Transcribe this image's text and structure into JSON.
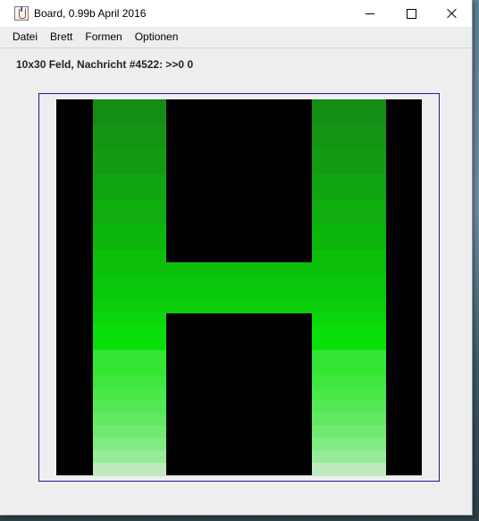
{
  "window": {
    "title": "Board, 0.99b April 2016",
    "icon": "java-cup-icon"
  },
  "menu": {
    "items": [
      "Datei",
      "Brett",
      "Formen",
      "Optionen"
    ]
  },
  "status": {
    "text": "10x30 Feld, Nachricht #4522: >>0 0"
  },
  "board": {
    "columns": 10,
    "rows": 30,
    "background": "#000000",
    "lit_columns": [
      1,
      2,
      3,
      4,
      5,
      6,
      7,
      8
    ],
    "crossbar_columns": [
      3,
      4,
      5,
      6
    ],
    "crossbar_rows": [
      13,
      14,
      15,
      16
    ],
    "row_colors": [
      "#138d13",
      "#138d13",
      "#149514",
      "#149514",
      "#139c13",
      "#139c13",
      "#11a411",
      "#11a411",
      "#0fad0f",
      "#0fad0f",
      "#0cb60c",
      "#0cb60c",
      "#0bbf0b",
      "#0bbf0b",
      "#0bc70b",
      "#0bc70b",
      "#0bce0b",
      "#0bd60b",
      "#0bdf0b",
      "#0bdf0b",
      "#33e633",
      "#33e633",
      "#3fe73f",
      "#4ae84a",
      "#55e855",
      "#62e962",
      "#70ea70",
      "#82eb82",
      "#98ec98",
      "#bfeabf"
    ]
  }
}
